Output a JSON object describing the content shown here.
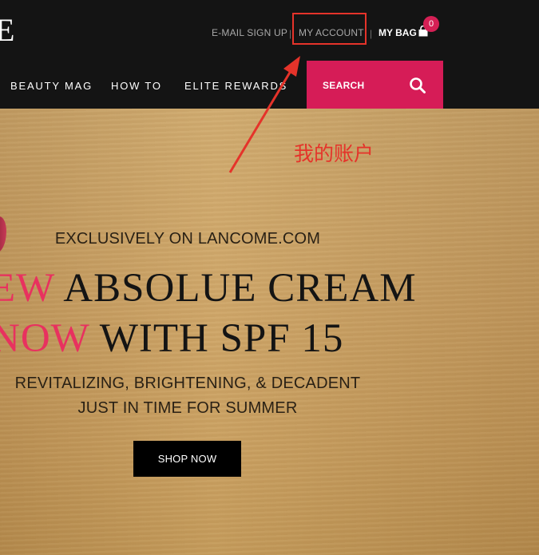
{
  "header": {
    "logo_fragment": "E",
    "utility": {
      "email_signup": "E-MAIL SIGN UP",
      "separator": "|",
      "my_account": "MY ACCOUNT",
      "my_bag": "MY BAG",
      "bag_count": "0",
      "bag_icon": "shopping-bag-icon"
    },
    "nav": {
      "items": [
        {
          "label": "BEAUTY MAG"
        },
        {
          "label": "HOW TO"
        },
        {
          "label": "ELITE REWARDS"
        }
      ]
    },
    "search": {
      "label": "SEARCH",
      "icon": "search-icon"
    }
  },
  "annotation": {
    "label": "我的账户",
    "color": "#e5332a"
  },
  "hero": {
    "kicker": "EXCLUSIVELY ON LANCOME.COM",
    "headline_line1_accent": "EW",
    "headline_line1_rest": " ABSOLUE CREAM",
    "headline_line2_accent": "NOW",
    "headline_line2_rest": " WITH SPF 15",
    "sub_line1": "REVITALIZING, BRIGHTENING, & DECADENT",
    "sub_line2": "JUST IN TIME FOR SUMMER",
    "cta_label": "SHOP NOW"
  },
  "colors": {
    "header_bg": "#141414",
    "accent_pink": "#d61c57",
    "headline_accent": "#e8315f",
    "hero_bg": "#cba56a"
  }
}
